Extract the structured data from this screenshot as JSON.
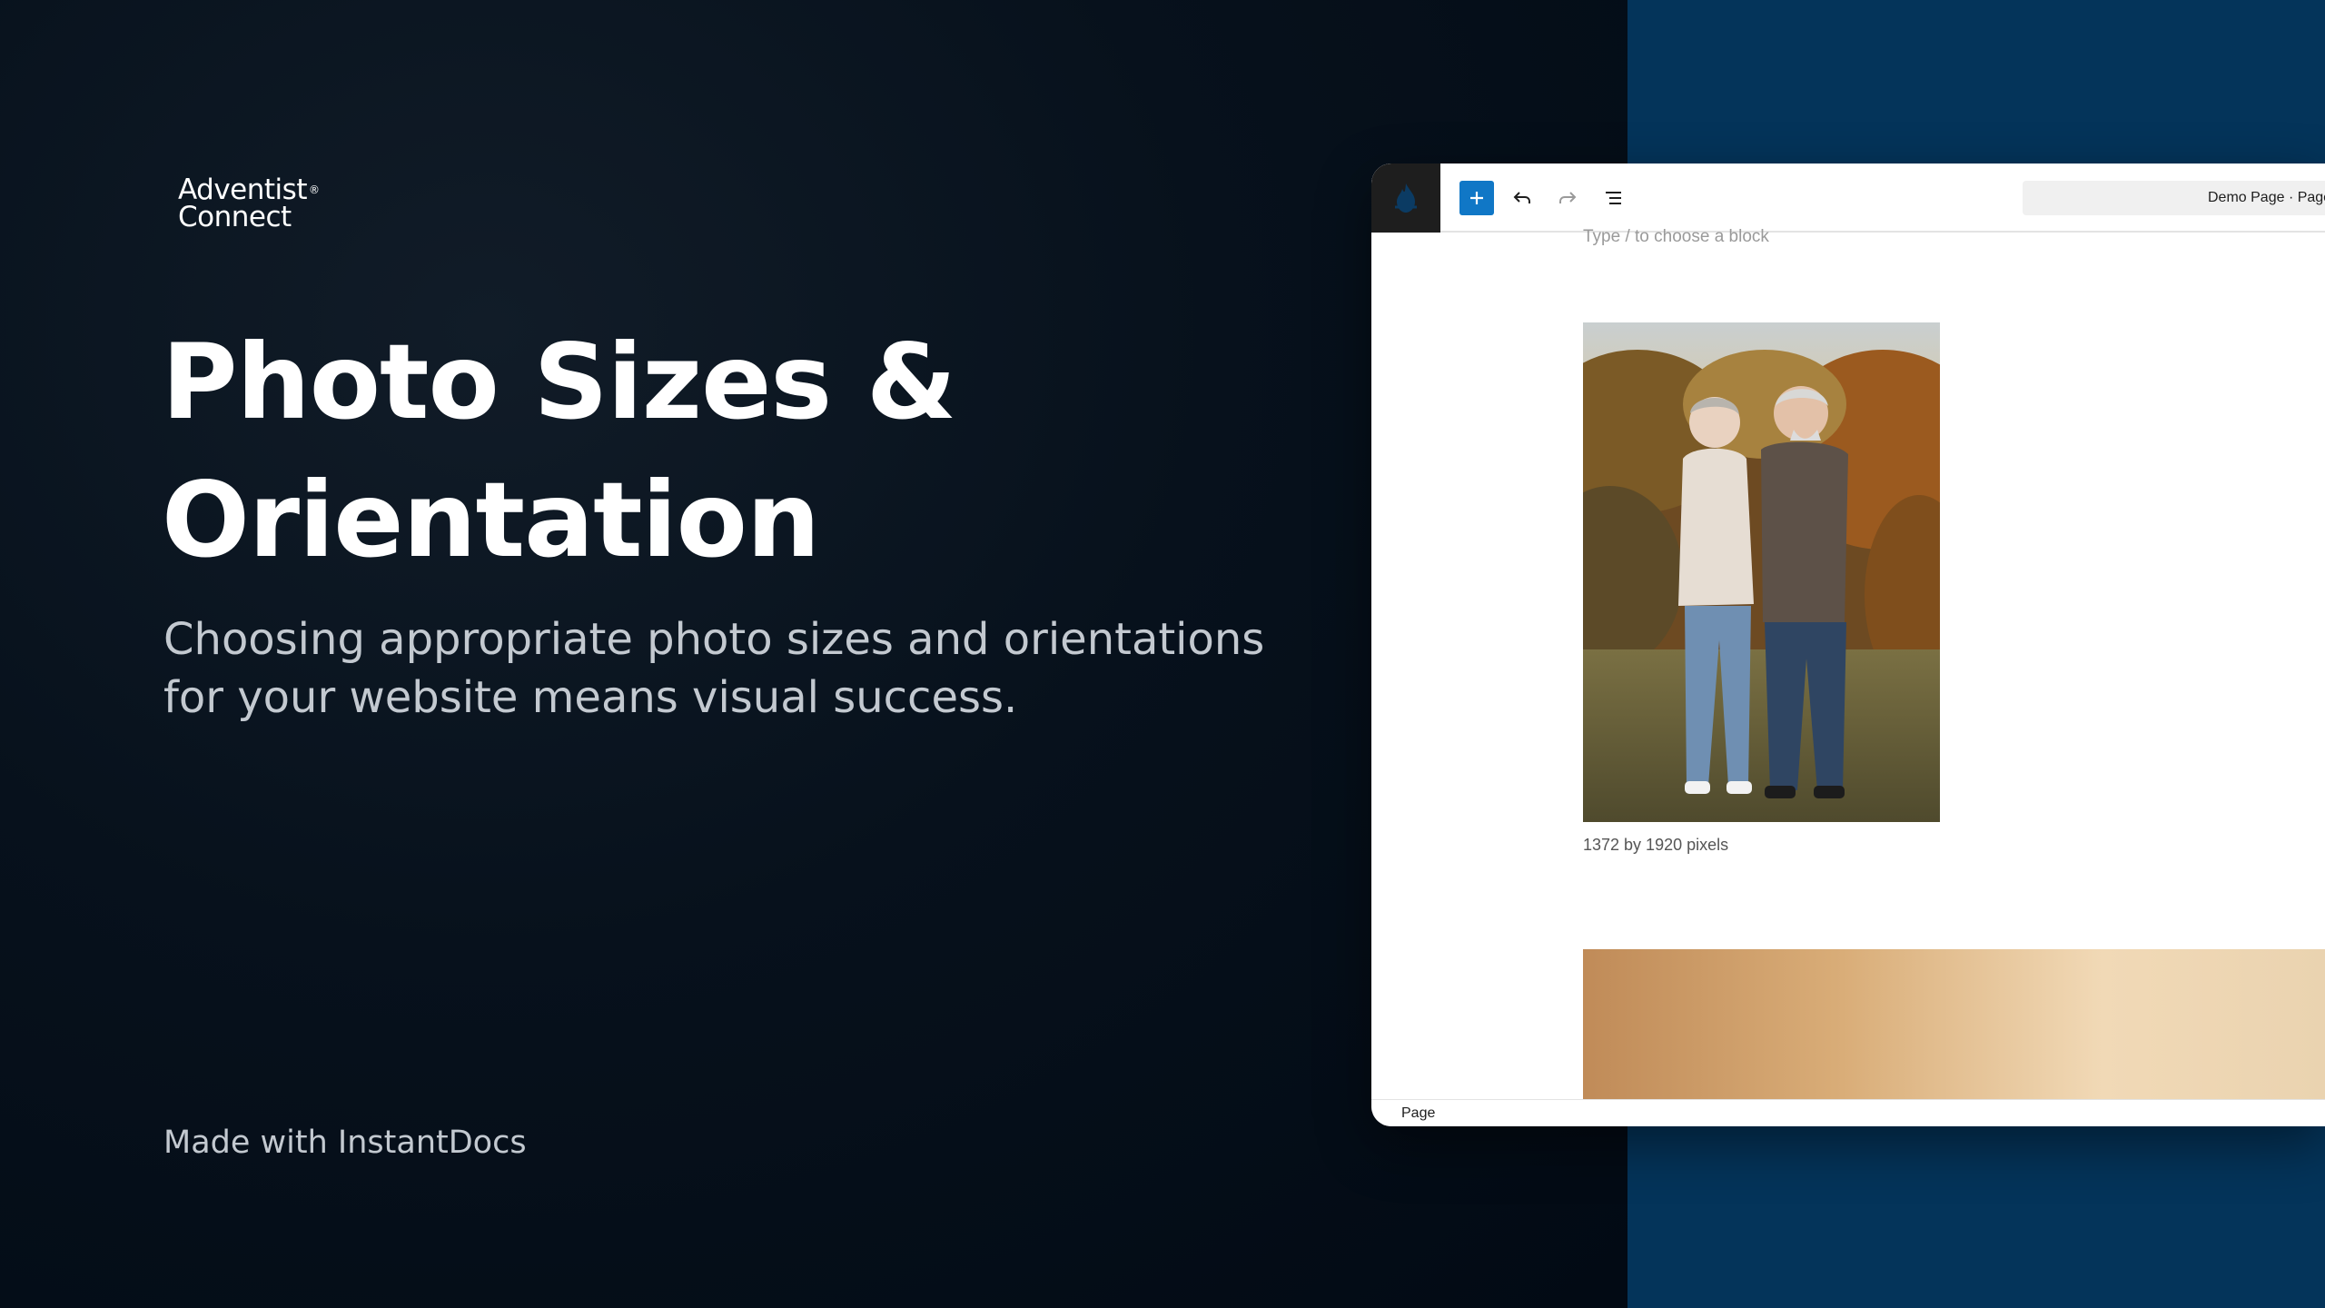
{
  "brand": {
    "logo_line1": "Adventist",
    "logo_mark": "®",
    "logo_line2": "Connect"
  },
  "hero": {
    "title_line1": "Photo Sizes &",
    "title_line2": "Orientation",
    "subtitle_line1": "Choosing appropriate photo sizes and orientations",
    "subtitle_line2": "for your website means visual success."
  },
  "footer": {
    "made_with": "Made with InstantDocs"
  },
  "editor": {
    "toolbar": {
      "site_icon": "adventist-flame-icon",
      "add_block_icon": "plus-icon",
      "undo_icon": "undo-icon",
      "redo_icon": "redo-icon",
      "list_view_icon": "list-view-icon",
      "document_title": "Demo Page · Page"
    },
    "canvas": {
      "block_placeholder": "Type / to choose a block",
      "photo_caption": "1372 by 1920 pixels"
    },
    "statusbar": {
      "breadcrumb": "Page"
    }
  },
  "colors": {
    "left_background": "#07111c",
    "right_background": "#04345a",
    "accent": "#1077c6",
    "white": "#ffffff"
  }
}
